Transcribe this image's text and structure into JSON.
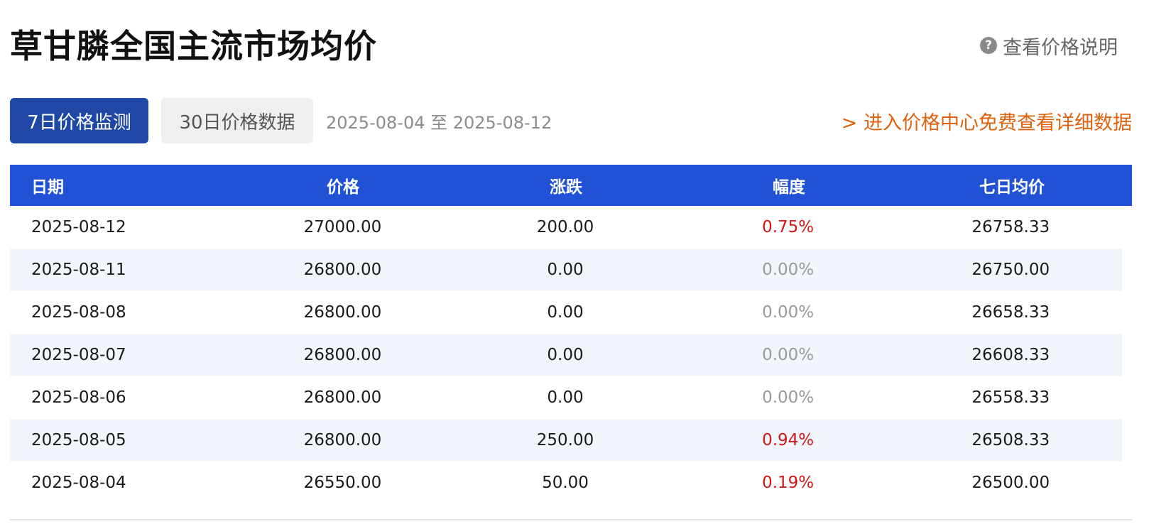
{
  "header": {
    "title": "草甘膦全国主流市场均价",
    "help_icon": "?",
    "help_label": "查看价格说明"
  },
  "toolbar": {
    "tab_7d": "7日价格监测",
    "tab_30d": "30日价格数据",
    "date_range": "2025-08-04 至 2025-08-12",
    "detail_link": "> 进入价格中心免费查看详细数据"
  },
  "table": {
    "headers": {
      "date": "日期",
      "price": "价格",
      "change": "涨跌",
      "pct": "幅度",
      "avg7": "七日均价"
    },
    "rows": [
      {
        "date": "2025-08-12",
        "price": "27000.00",
        "change": "200.00",
        "pct": "0.75%",
        "avg7": "26758.33"
      },
      {
        "date": "2025-08-11",
        "price": "26800.00",
        "change": "0.00",
        "pct": "0.00%",
        "avg7": "26750.00"
      },
      {
        "date": "2025-08-08",
        "price": "26800.00",
        "change": "0.00",
        "pct": "0.00%",
        "avg7": "26658.33"
      },
      {
        "date": "2025-08-07",
        "price": "26800.00",
        "change": "0.00",
        "pct": "0.00%",
        "avg7": "26608.33"
      },
      {
        "date": "2025-08-06",
        "price": "26800.00",
        "change": "0.00",
        "pct": "0.00%",
        "avg7": "26558.33"
      },
      {
        "date": "2025-08-05",
        "price": "26800.00",
        "change": "250.00",
        "pct": "0.94%",
        "avg7": "26508.33"
      },
      {
        "date": "2025-08-04",
        "price": "26550.00",
        "change": "50.00",
        "pct": "0.19%",
        "avg7": "26500.00"
      }
    ]
  },
  "colors": {
    "header_bg": "#2152d6",
    "active_tab": "#1f48a6",
    "link_orange": "#e0620f",
    "up_red": "#d01818",
    "flat_gray": "#9a9a9a"
  }
}
